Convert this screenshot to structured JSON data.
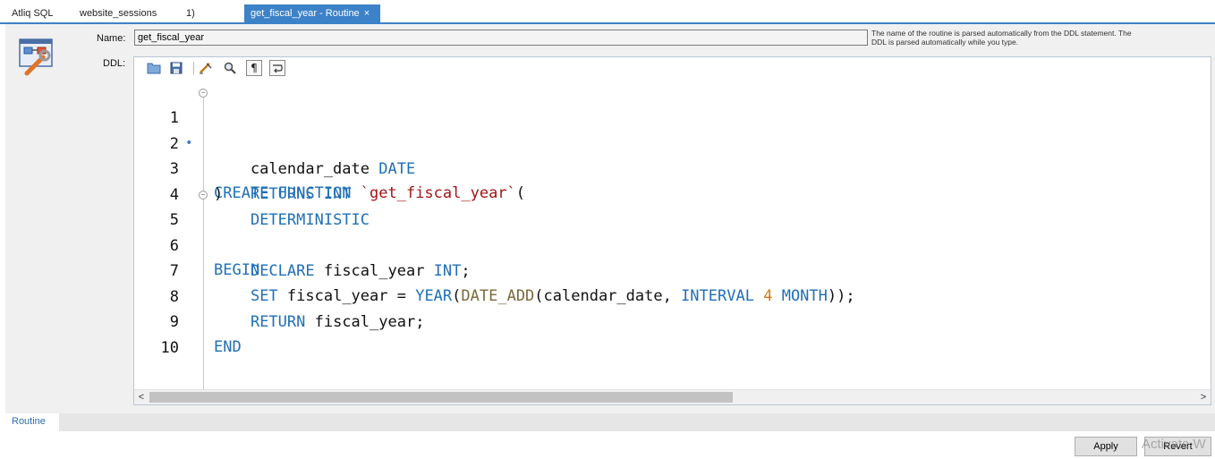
{
  "tabs": [
    {
      "label": "Atliq SQL",
      "active": false
    },
    {
      "label": "website_sessions",
      "active": false
    },
    {
      "label": "1)",
      "active": false
    },
    {
      "label": "get_fiscal_year - Routine",
      "active": true,
      "close": "×"
    }
  ],
  "form": {
    "name_label": "Name:",
    "name_value": "get_fiscal_year",
    "ddl_label": "DDL:",
    "hint": "The name of the routine is parsed automatically from the DDL statement. The DDL is parsed automatically while you type."
  },
  "toolbar": [
    "open-icon",
    "save-icon",
    "beautify-icon",
    "find-icon",
    "invisibles-icon",
    "wrap-icon"
  ],
  "editor": {
    "lines": [
      {
        "num": "1",
        "text": "CREATE FUNCTION `get_fiscal_year`("
      },
      {
        "num": "2",
        "text": "    calendar_date DATE"
      },
      {
        "num": "3",
        "text": ")   RETURNS INT"
      },
      {
        "num": "4",
        "text": "    DETERMINISTIC"
      },
      {
        "num": "5",
        "text": "BEGIN"
      },
      {
        "num": "6",
        "text": "    DECLARE fiscal_year INT;"
      },
      {
        "num": "7",
        "text": "    SET fiscal_year = YEAR(DATE_ADD(calendar_date, INTERVAL 4 MONTH));"
      },
      {
        "num": "8",
        "text": "    RETURN fiscal_year;"
      },
      {
        "num": "9",
        "text": "END"
      },
      {
        "num": "10",
        "text": ""
      }
    ],
    "scroll_left": "<",
    "scroll_right": ">"
  },
  "bottom_tabs": {
    "routine": "Routine"
  },
  "buttons": {
    "apply": "Apply",
    "revert": "Revert"
  },
  "watermark": "Activate W",
  "colors": {
    "accent": "#3c82c9",
    "keyword": "#1f6fb8",
    "string": "#a31515",
    "number": "#d07a1a"
  }
}
